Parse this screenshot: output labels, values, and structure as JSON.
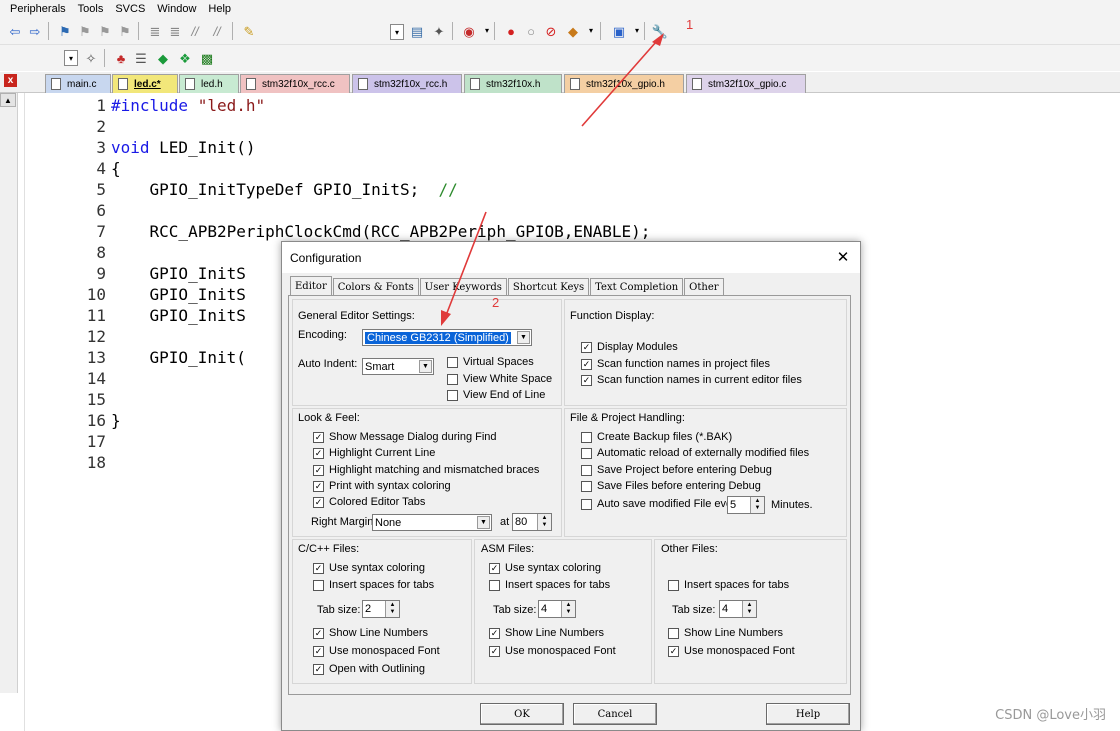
{
  "menu": [
    "Peripherals",
    "Tools",
    "SVCS",
    "Window",
    "Help"
  ],
  "toolbar_icons": [
    "back-arrow",
    "forward-arrow",
    "bookmark",
    "bookmark-prev",
    "bookmark-next",
    "bookmark-clear",
    "indent",
    "unindent",
    "comment",
    "uncomment",
    "find-in-files",
    "target-dropdown",
    "load",
    "magic-wand",
    "debug-start",
    "breakpoint",
    "breakpoint-disable",
    "breakpoint-kill",
    "tools",
    "window-layout",
    "configuration-wrench"
  ],
  "tabs": [
    {
      "label": "main.c",
      "color": "#c8d7ef"
    },
    {
      "label": "led.c*",
      "color": "#f2e77a"
    },
    {
      "label": "led.h",
      "color": "#c8ead2"
    },
    {
      "label": "stm32f10x_rcc.c",
      "color": "#f0c2c2"
    },
    {
      "label": "stm32f10x_rcc.h",
      "color": "#ccc3ea"
    },
    {
      "label": "stm32f10x.h",
      "color": "#bfe2c9"
    },
    {
      "label": "stm32f10x_gpio.h",
      "color": "#f4cfa3"
    },
    {
      "label": "stm32f10x_gpio.c",
      "color": "#ddd3ea"
    }
  ],
  "line_numbers": [
    "1",
    "2",
    "3",
    "4",
    "5",
    "6",
    "7",
    "8",
    "9",
    "10",
    "11",
    "12",
    "13",
    "14",
    "15",
    "16",
    "17",
    "18"
  ],
  "code": {
    "l1_kw": "#include",
    "l1_str": "\"led.h\"",
    "l3_kw": "void",
    "l3_rest": " LED_Init()",
    "l4": "{",
    "l5": "    GPIO_InitTypeDef GPIO_InitS;  ",
    "l5_cmt": "//",
    "l7": "    RCC_APB2PeriphClockCmd(RCC_APB2Periph_GPIOB,ENABLE);",
    "l9": "    GPIO_InitS",
    "l10": "    GPIO_InitS",
    "l11": "    GPIO_InitS",
    "l13": "    GPIO_Init(",
    "l16": "}"
  },
  "annotations": {
    "n1": "1",
    "n2": "2",
    "color": "#e03a3a"
  },
  "watermark": "CSDN @Love小羽",
  "dialog": {
    "title": "Configuration",
    "tabs": [
      "Editor",
      "Colors & Fonts",
      "User Keywords",
      "Shortcut Keys",
      "Text Completion",
      "Other"
    ],
    "general": {
      "title": "General Editor Settings:",
      "encoding_label": "Encoding:",
      "encoding_value": "Chinese GB2312 (Simplified)",
      "auto_indent_label": "Auto Indent:",
      "auto_indent_value": "Smart",
      "options": [
        {
          "label": "Virtual Spaces",
          "checked": false
        },
        {
          "label": "View White Space",
          "checked": false
        },
        {
          "label": "View End of Line",
          "checked": false
        }
      ]
    },
    "function_display": {
      "title": "Function Display:",
      "options": [
        {
          "label": "Display Modules",
          "checked": true
        },
        {
          "label": "Scan function names in project files",
          "checked": true
        },
        {
          "label": "Scan function names in current editor files",
          "checked": true
        }
      ]
    },
    "look_feel": {
      "title": "Look & Feel:",
      "options": [
        {
          "label": "Show Message Dialog during Find",
          "checked": true
        },
        {
          "label": "Highlight Current Line",
          "checked": true
        },
        {
          "label": "Highlight matching and mismatched braces",
          "checked": true
        },
        {
          "label": "Print with syntax coloring",
          "checked": true
        },
        {
          "label": "Colored Editor Tabs",
          "checked": true
        }
      ],
      "right_margin_label": "Right Margin:",
      "right_margin_value": "None",
      "at_label": "at",
      "at_value": "80"
    },
    "file_handling": {
      "title": "File & Project Handling:",
      "options": [
        {
          "label": "Create Backup files (*.BAK)",
          "checked": false
        },
        {
          "label": "Automatic reload of externally modified files",
          "checked": false
        },
        {
          "label": "Save Project before entering Debug",
          "checked": false
        },
        {
          "label": "Save Files before entering Debug",
          "checked": false
        },
        {
          "label": "Auto save modified File every",
          "checked": false
        }
      ],
      "autosave_value": "5",
      "minutes_label": "Minutes."
    },
    "c_files": {
      "title": "C/C++ Files:",
      "use_syntax": {
        "label": "Use syntax coloring",
        "checked": true
      },
      "insert_spaces": {
        "label": "Insert spaces for tabs",
        "checked": false
      },
      "tab_size_label": "Tab size:",
      "tab_size": "2",
      "show_ln": {
        "label": "Show Line Numbers",
        "checked": true
      },
      "mono": {
        "label": "Use monospaced Font",
        "checked": true
      },
      "outline": {
        "label": "Open with Outlining",
        "checked": true
      }
    },
    "asm_files": {
      "title": "ASM Files:",
      "use_syntax": {
        "label": "Use syntax coloring",
        "checked": true
      },
      "insert_spaces": {
        "label": "Insert spaces for tabs",
        "checked": false
      },
      "tab_size_label": "Tab size:",
      "tab_size": "4",
      "show_ln": {
        "label": "Show Line Numbers",
        "checked": true
      },
      "mono": {
        "label": "Use monospaced Font",
        "checked": true
      }
    },
    "other_files": {
      "title": "Other Files:",
      "insert_spaces": {
        "label": "Insert spaces for tabs",
        "checked": false
      },
      "tab_size_label": "Tab size:",
      "tab_size": "4",
      "show_ln": {
        "label": "Show Line Numbers",
        "checked": false
      },
      "mono": {
        "label": "Use monospaced Font",
        "checked": true
      }
    },
    "buttons": {
      "ok": "OK",
      "cancel": "Cancel",
      "help": "Help"
    }
  }
}
